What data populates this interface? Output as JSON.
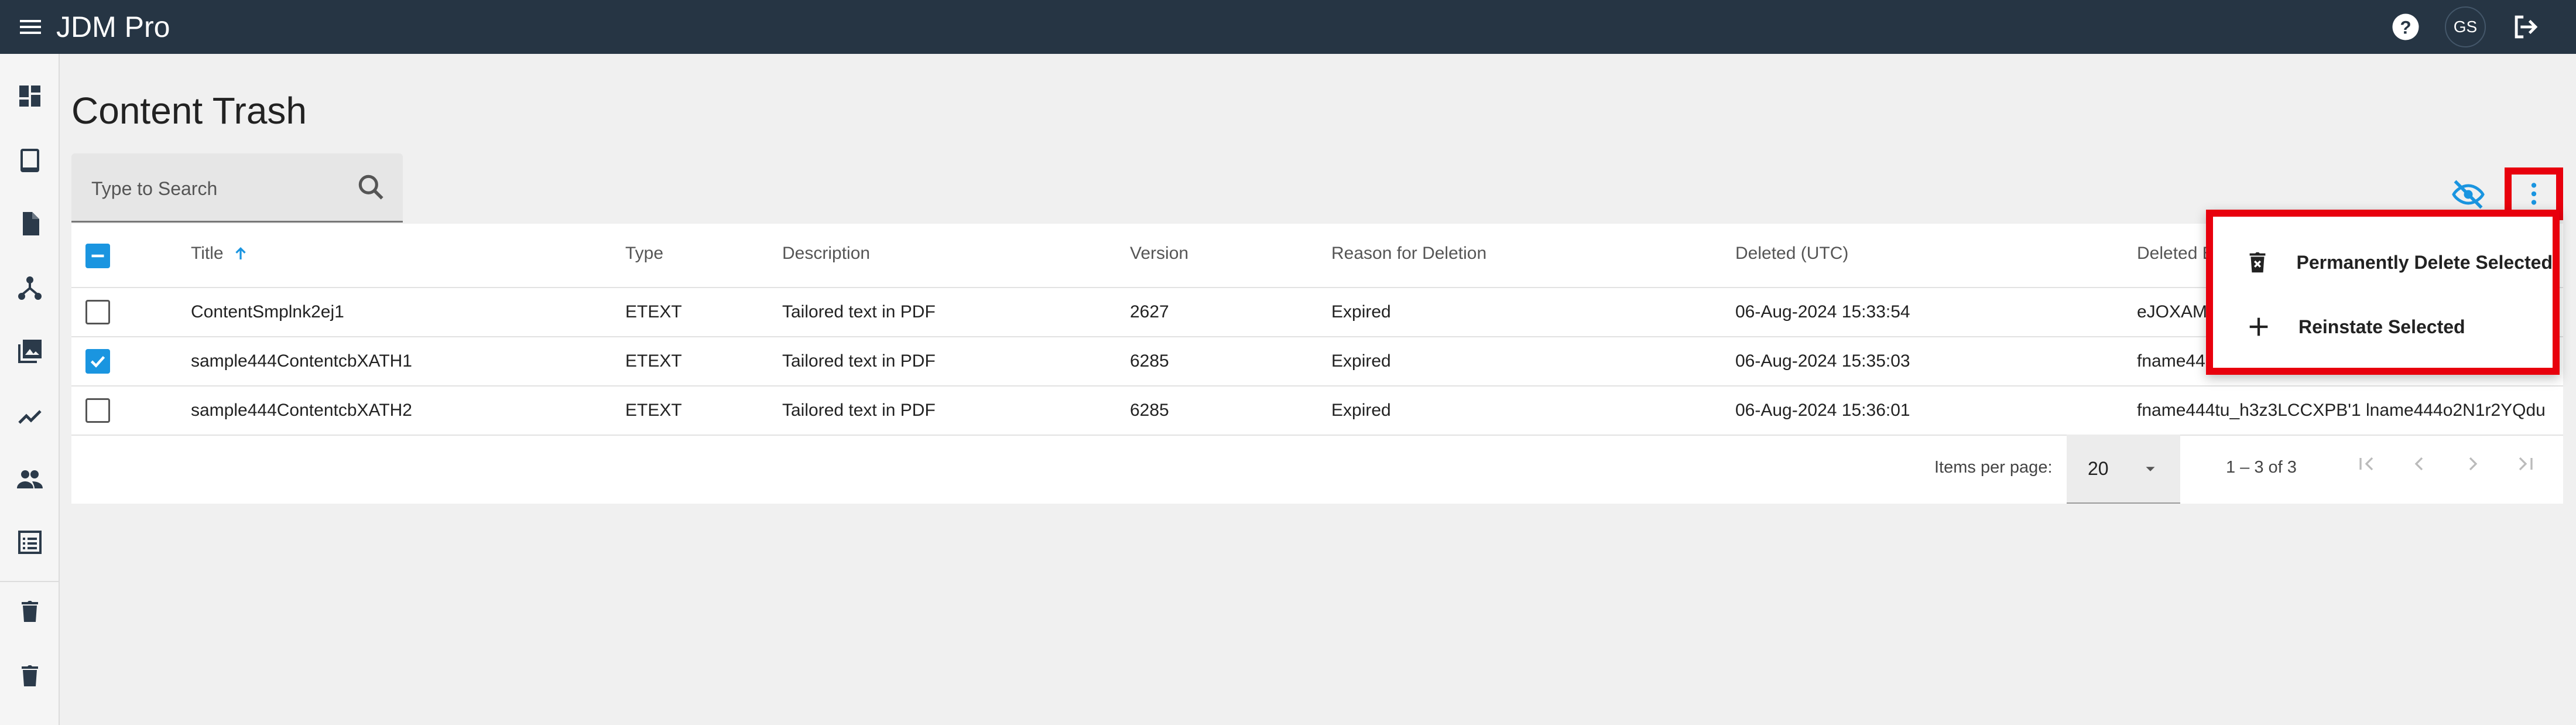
{
  "app": {
    "title": "JDM Pro",
    "user_initials": "GS"
  },
  "colors": {
    "topbar": "#263544",
    "accent": "#1a95e0",
    "highlight": "#e8000d"
  },
  "sidebar": {
    "items": [
      {
        "icon": "dashboard-icon"
      },
      {
        "icon": "tablet-icon"
      },
      {
        "icon": "document-icon"
      },
      {
        "icon": "hierarchy-icon"
      },
      {
        "icon": "image-library-icon"
      },
      {
        "icon": "analytics-icon"
      },
      {
        "icon": "users-icon"
      },
      {
        "icon": "list-icon"
      },
      {
        "icon": "trash-icon"
      },
      {
        "icon": "trash-icon"
      }
    ]
  },
  "page": {
    "title": "Content Trash"
  },
  "search": {
    "placeholder": "Type to Search"
  },
  "table": {
    "columns": [
      "Title",
      "Type",
      "Description",
      "Version",
      "Reason for Deletion",
      "Deleted (UTC)",
      "Deleted By"
    ],
    "sort": {
      "column": "Title",
      "direction": "asc"
    },
    "rows": [
      {
        "checked": false,
        "title": "ContentSmplnk2ej1",
        "type": "ETEXT",
        "description": "Tailored text in PDF",
        "version": "2627",
        "reason": "Expired",
        "deleted": "06-Aug-2024 15:33:54",
        "deleted_by": "eJOXAM"
      },
      {
        "checked": true,
        "title": "sample444ContentcbXATH1",
        "type": "ETEXT",
        "description": "Tailored text in PDF",
        "version": "6285",
        "reason": "Expired",
        "deleted": "06-Aug-2024 15:35:03",
        "deleted_by": "fname44"
      },
      {
        "checked": false,
        "title": "sample444ContentcbXATH2",
        "type": "ETEXT",
        "description": "Tailored text in PDF",
        "version": "6285",
        "reason": "Expired",
        "deleted": "06-Aug-2024 15:36:01",
        "deleted_by": "fname444tu_h3z3LCCXPB'1 lname444o2N1r2YQdu..."
      }
    ]
  },
  "pagination": {
    "label": "Items per page:",
    "page_size": "20",
    "range": "1 – 3 of 3"
  },
  "menu": {
    "items": [
      {
        "label": "Permanently Delete Selected",
        "icon": "delete-forever-icon"
      },
      {
        "label": "Reinstate Selected",
        "icon": "plus-icon"
      }
    ]
  }
}
